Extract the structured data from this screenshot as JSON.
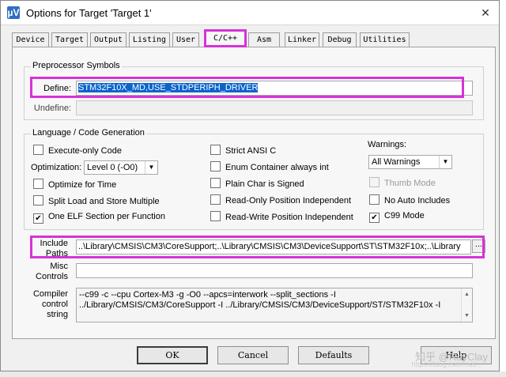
{
  "window": {
    "title": "Options for Target 'Target 1'",
    "app_icon": "µV",
    "close_glyph": "✕"
  },
  "tabs": [
    {
      "label": "Device",
      "active": false
    },
    {
      "label": "Target",
      "active": false
    },
    {
      "label": "Output",
      "active": false
    },
    {
      "label": "Listing",
      "active": false
    },
    {
      "label": "User",
      "active": false
    },
    {
      "label": "C/C++",
      "active": true
    },
    {
      "label": "Asm",
      "active": false
    },
    {
      "label": "Linker",
      "active": false
    },
    {
      "label": "Debug",
      "active": false
    },
    {
      "label": "Utilities",
      "active": false
    }
  ],
  "preprocessor": {
    "title": "Preprocessor Symbols",
    "define_label": "Define:",
    "define_value": "STM32F10X_MD,USE_STDPERIPH_DRIVER",
    "undefine_label": "Undefine:",
    "undefine_value": ""
  },
  "language": {
    "title": "Language / Code Generation",
    "execute_only": {
      "label": "Execute-only Code",
      "checked": false
    },
    "optimization_label": "Optimization:",
    "optimization_value": "Level 0 (-O0)",
    "optimize_time": {
      "label": "Optimize for Time",
      "checked": false
    },
    "split_load": {
      "label": "Split Load and Store Multiple",
      "checked": false
    },
    "one_elf": {
      "label": "One ELF Section per Function",
      "checked": true
    },
    "strict_ansi": {
      "label": "Strict ANSI C",
      "checked": false
    },
    "enum_container": {
      "label": "Enum Container always int",
      "checked": false
    },
    "plain_char": {
      "label": "Plain Char is Signed",
      "checked": false
    },
    "ro_pos": {
      "label": "Read-Only Position Independent",
      "checked": false
    },
    "rw_pos": {
      "label": "Read-Write Position Independent",
      "checked": false
    },
    "warnings_label": "Warnings:",
    "warnings_value": "All Warnings",
    "thumb_mode": {
      "label": "Thumb Mode",
      "checked": false,
      "disabled": true
    },
    "no_auto_includes": {
      "label": "No Auto Includes",
      "checked": false
    },
    "c99_mode": {
      "label": "C99 Mode",
      "checked": true
    }
  },
  "include_paths": {
    "label_line1": "Include",
    "label_line2": "Paths",
    "value": "..\\Library\\CMSIS\\CM3\\CoreSupport;..\\Library\\CMSIS\\CM3\\DeviceSupport\\ST\\STM32F10x;..\\Library",
    "browse_label": "..."
  },
  "misc_controls": {
    "label_line1": "Misc",
    "label_line2": "Controls",
    "value": ""
  },
  "compiler_control": {
    "label_line1": "Compiler",
    "label_line2": "control",
    "label_line3": "string",
    "line1": "--c99 -c --cpu Cortex-M3 -g -O0 --apcs=interwork --split_sections -I",
    "line2": "../Library/CMSIS/CM3/CoreSupport -I ../Library/CMSIS/CM3/DeviceSupport/ST/STM32F10x -I"
  },
  "buttons": {
    "ok": "OK",
    "cancel": "Cancel",
    "defaults": "Defaults",
    "help": "Help"
  },
  "watermark": {
    "text": "知乎 @RayClay",
    "url": "https://blog.csdn.net/..."
  },
  "colors": {
    "highlight": "#d633d6",
    "selection": "#0a64cc"
  }
}
